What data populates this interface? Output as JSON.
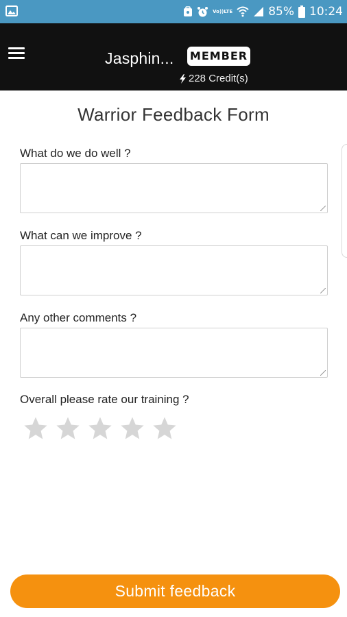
{
  "status_bar": {
    "battery": "85%",
    "time": "10:24",
    "volte_line1": "Vo))",
    "volte_line2": "LTE",
    "icons": [
      "image-icon",
      "nfc-icon",
      "alarm-icon",
      "volte-icon",
      "wifi-icon",
      "signal-icon",
      "battery-icon"
    ]
  },
  "header": {
    "username": "Jasphin...",
    "badge": "MEMBER",
    "credits": "228 Credit(s)",
    "menu_icon": "hamburger-menu-icon",
    "background": "#111111"
  },
  "form": {
    "title": "Warrior Feedback Form",
    "questions": [
      {
        "label": "What do we do well ?",
        "value": ""
      },
      {
        "label": "What can we improve ?",
        "value": ""
      },
      {
        "label": "Any other comments ?",
        "value": ""
      }
    ],
    "rating_label": "Overall please rate our training ?",
    "rating": {
      "value": 0,
      "max": 5
    },
    "submit_label": "Submit feedback"
  },
  "colors": {
    "status_bar": "#4a98c2",
    "accent": "#f5910f",
    "star_empty": "#d6d6d6"
  }
}
